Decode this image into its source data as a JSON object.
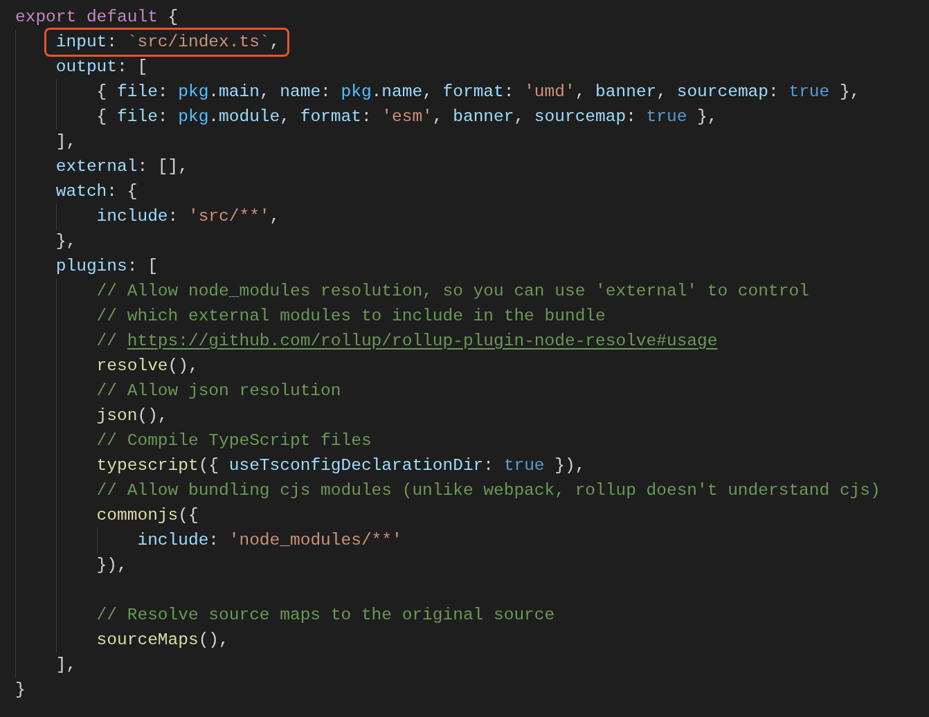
{
  "editor": {
    "lines": [
      {
        "annotated": false,
        "tokens": [
          {
            "kind": "keyword",
            "text": "export default"
          },
          {
            "kind": "punct",
            "text": " {"
          }
        ]
      },
      {
        "annotated": true,
        "tokens": [
          {
            "kind": "property",
            "text": "    input"
          },
          {
            "kind": "punct",
            "text": ": "
          },
          {
            "kind": "string",
            "text": "`src/index.ts`"
          },
          {
            "kind": "punct",
            "text": ","
          }
        ]
      },
      {
        "annotated": false,
        "tokens": [
          {
            "kind": "property",
            "text": "    output"
          },
          {
            "kind": "punct",
            "text": ": ["
          }
        ]
      },
      {
        "annotated": false,
        "tokens": [
          {
            "kind": "punct",
            "text": "        { "
          },
          {
            "kind": "property",
            "text": "file"
          },
          {
            "kind": "punct",
            "text": ": "
          },
          {
            "kind": "variable",
            "text": "pkg"
          },
          {
            "kind": "punct",
            "text": "."
          },
          {
            "kind": "property",
            "text": "main"
          },
          {
            "kind": "punct",
            "text": ", "
          },
          {
            "kind": "property",
            "text": "name"
          },
          {
            "kind": "punct",
            "text": ": "
          },
          {
            "kind": "variable",
            "text": "pkg"
          },
          {
            "kind": "punct",
            "text": "."
          },
          {
            "kind": "property",
            "text": "name"
          },
          {
            "kind": "punct",
            "text": ", "
          },
          {
            "kind": "property",
            "text": "format"
          },
          {
            "kind": "punct",
            "text": ": "
          },
          {
            "kind": "string",
            "text": "'umd'"
          },
          {
            "kind": "punct",
            "text": ", "
          },
          {
            "kind": "property",
            "text": "banner"
          },
          {
            "kind": "punct",
            "text": ", "
          },
          {
            "kind": "property",
            "text": "sourcemap"
          },
          {
            "kind": "punct",
            "text": ": "
          },
          {
            "kind": "boolean",
            "text": "true"
          },
          {
            "kind": "punct",
            "text": " },"
          }
        ]
      },
      {
        "annotated": false,
        "tokens": [
          {
            "kind": "punct",
            "text": "        { "
          },
          {
            "kind": "property",
            "text": "file"
          },
          {
            "kind": "punct",
            "text": ": "
          },
          {
            "kind": "variable",
            "text": "pkg"
          },
          {
            "kind": "punct",
            "text": "."
          },
          {
            "kind": "property",
            "text": "module"
          },
          {
            "kind": "punct",
            "text": ", "
          },
          {
            "kind": "property",
            "text": "format"
          },
          {
            "kind": "punct",
            "text": ": "
          },
          {
            "kind": "string",
            "text": "'esm'"
          },
          {
            "kind": "punct",
            "text": ", "
          },
          {
            "kind": "property",
            "text": "banner"
          },
          {
            "kind": "punct",
            "text": ", "
          },
          {
            "kind": "property",
            "text": "sourcemap"
          },
          {
            "kind": "punct",
            "text": ": "
          },
          {
            "kind": "boolean",
            "text": "true"
          },
          {
            "kind": "punct",
            "text": " },"
          }
        ]
      },
      {
        "annotated": false,
        "tokens": [
          {
            "kind": "punct",
            "text": "    ],"
          }
        ]
      },
      {
        "annotated": false,
        "tokens": [
          {
            "kind": "property",
            "text": "    external"
          },
          {
            "kind": "punct",
            "text": ": [],"
          }
        ]
      },
      {
        "annotated": false,
        "tokens": [
          {
            "kind": "property",
            "text": "    watch"
          },
          {
            "kind": "punct",
            "text": ": {"
          }
        ]
      },
      {
        "annotated": false,
        "tokens": [
          {
            "kind": "property",
            "text": "        include"
          },
          {
            "kind": "punct",
            "text": ": "
          },
          {
            "kind": "string",
            "text": "'src/**'"
          },
          {
            "kind": "punct",
            "text": ","
          }
        ]
      },
      {
        "annotated": false,
        "tokens": [
          {
            "kind": "punct",
            "text": "    },"
          }
        ]
      },
      {
        "annotated": false,
        "tokens": [
          {
            "kind": "property",
            "text": "    plugins"
          },
          {
            "kind": "punct",
            "text": ": ["
          }
        ]
      },
      {
        "annotated": false,
        "tokens": [
          {
            "kind": "comment",
            "text": "        // Allow node_modules resolution, so you can use 'external' to control"
          }
        ]
      },
      {
        "annotated": false,
        "tokens": [
          {
            "kind": "comment",
            "text": "        // which external modules to include in the bundle"
          }
        ]
      },
      {
        "annotated": false,
        "tokens": [
          {
            "kind": "comment",
            "text": "        // "
          },
          {
            "kind": "link",
            "text": "https://github.com/rollup/rollup-plugin-node-resolve#usage"
          }
        ]
      },
      {
        "annotated": false,
        "tokens": [
          {
            "kind": "function",
            "text": "        resolve"
          },
          {
            "kind": "punct",
            "text": "(),"
          }
        ]
      },
      {
        "annotated": false,
        "tokens": [
          {
            "kind": "comment",
            "text": "        // Allow json resolution"
          }
        ]
      },
      {
        "annotated": false,
        "tokens": [
          {
            "kind": "function",
            "text": "        json"
          },
          {
            "kind": "punct",
            "text": "(),"
          }
        ]
      },
      {
        "annotated": false,
        "tokens": [
          {
            "kind": "comment",
            "text": "        // Compile TypeScript files"
          }
        ]
      },
      {
        "annotated": false,
        "tokens": [
          {
            "kind": "function",
            "text": "        typescript"
          },
          {
            "kind": "punct",
            "text": "({ "
          },
          {
            "kind": "property",
            "text": "useTsconfigDeclarationDir"
          },
          {
            "kind": "punct",
            "text": ": "
          },
          {
            "kind": "boolean",
            "text": "true"
          },
          {
            "kind": "punct",
            "text": " }),"
          }
        ]
      },
      {
        "annotated": false,
        "tokens": [
          {
            "kind": "comment",
            "text": "        // Allow bundling cjs modules (unlike webpack, rollup doesn't understand cjs)"
          }
        ]
      },
      {
        "annotated": false,
        "tokens": [
          {
            "kind": "function",
            "text": "        commonjs"
          },
          {
            "kind": "punct",
            "text": "({"
          }
        ]
      },
      {
        "annotated": false,
        "tokens": [
          {
            "kind": "property",
            "text": "            include"
          },
          {
            "kind": "punct",
            "text": ": "
          },
          {
            "kind": "string",
            "text": "'node_modules/**'"
          }
        ]
      },
      {
        "annotated": false,
        "tokens": [
          {
            "kind": "punct",
            "text": "        }),"
          }
        ]
      },
      {
        "annotated": false
      },
      {
        "annotated": false,
        "tokens": [
          {
            "kind": "comment",
            "text": "        // Resolve source maps to the original source"
          }
        ]
      },
      {
        "annotated": false,
        "tokens": [
          {
            "kind": "function",
            "text": "        sourceMaps"
          },
          {
            "kind": "punct",
            "text": "(),"
          }
        ]
      },
      {
        "annotated": false,
        "tokens": [
          {
            "kind": "punct",
            "text": "    ],"
          }
        ]
      },
      {
        "annotated": false,
        "tokens": [
          {
            "kind": "punct",
            "text": "}"
          }
        ]
      }
    ]
  }
}
